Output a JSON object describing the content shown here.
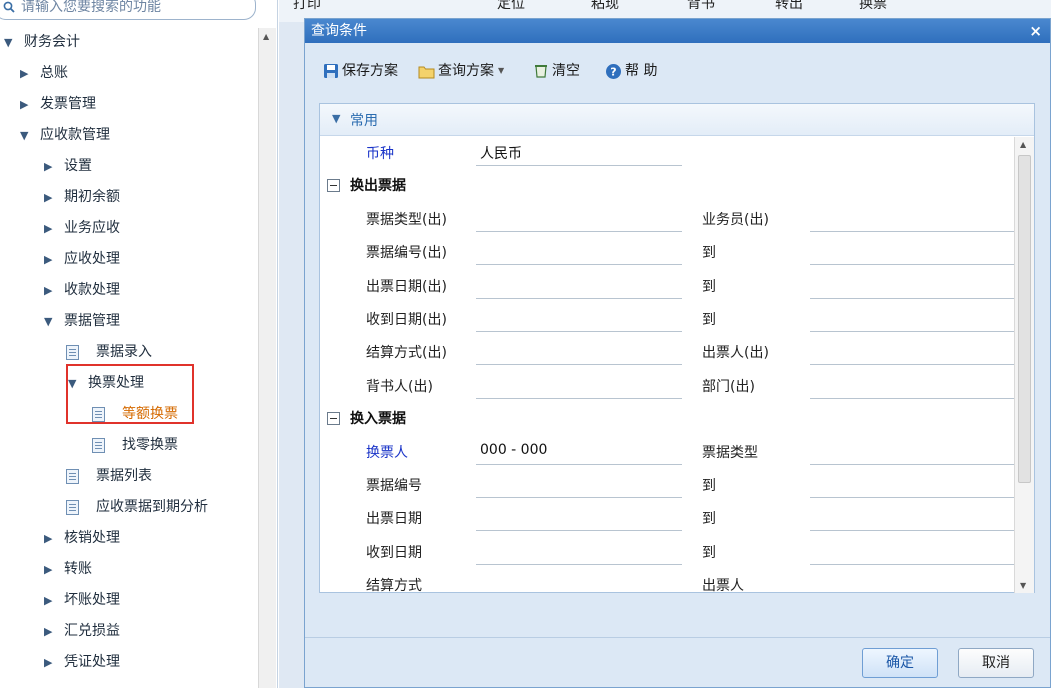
{
  "search": {
    "placeholder": "请输入您要搜索的功能"
  },
  "tree": [
    {
      "label": "财务会计",
      "level": 0,
      "kind": "folder",
      "expanded": true
    },
    {
      "label": "总账",
      "level": 1,
      "kind": "folder",
      "expanded": false
    },
    {
      "label": "发票管理",
      "level": 1,
      "kind": "folder",
      "expanded": false
    },
    {
      "label": "应收款管理",
      "level": 1,
      "kind": "folder",
      "expanded": true
    },
    {
      "label": "设置",
      "level": 2,
      "kind": "folder",
      "expanded": false
    },
    {
      "label": "期初余额",
      "level": 2,
      "kind": "folder",
      "expanded": false
    },
    {
      "label": "业务应收",
      "level": 2,
      "kind": "folder",
      "expanded": false
    },
    {
      "label": "应收处理",
      "level": 2,
      "kind": "folder",
      "expanded": false
    },
    {
      "label": "收款处理",
      "level": 2,
      "kind": "folder",
      "expanded": false
    },
    {
      "label": "票据管理",
      "level": 2,
      "kind": "folder",
      "expanded": true
    },
    {
      "label": "票据录入",
      "level": 3,
      "kind": "doc"
    },
    {
      "label": "换票处理",
      "level": 3,
      "kind": "folder",
      "expanded": true
    },
    {
      "label": "等额换票",
      "level": 4,
      "kind": "doc",
      "active": true
    },
    {
      "label": "找零换票",
      "level": 4,
      "kind": "doc"
    },
    {
      "label": "票据列表",
      "level": 3,
      "kind": "doc"
    },
    {
      "label": "应收票据到期分析",
      "level": 3,
      "kind": "doc"
    },
    {
      "label": "核销处理",
      "level": 2,
      "kind": "folder",
      "expanded": false
    },
    {
      "label": "转账",
      "level": 2,
      "kind": "folder",
      "expanded": false
    },
    {
      "label": "坏账处理",
      "level": 2,
      "kind": "folder",
      "expanded": false
    },
    {
      "label": "汇兑损益",
      "level": 2,
      "kind": "folder",
      "expanded": false
    },
    {
      "label": "凭证处理",
      "level": 2,
      "kind": "folder",
      "expanded": false
    }
  ],
  "background_toolbar": [
    "打印",
    "定位",
    "粘现",
    "背书",
    "转出",
    "换票"
  ],
  "dialog": {
    "title": "查询条件",
    "close": "×",
    "toolbar": {
      "save_scheme": "保存方案",
      "query_scheme": "查询方案",
      "clear": "清空",
      "help": "帮 助"
    },
    "panel_title": "常用",
    "form": {
      "currency": {
        "label": "币种",
        "value": "人民币"
      },
      "section_out": "换出票据",
      "out_rows": [
        {
          "left": "票据类型(出)",
          "right": "业务员(出)"
        },
        {
          "left": "票据编号(出)",
          "right": "到"
        },
        {
          "left": "出票日期(出)",
          "right": "到"
        },
        {
          "left": "收到日期(出)",
          "right": "到"
        },
        {
          "left": "结算方式(出)",
          "right": "出票人(出)"
        },
        {
          "left": "背书人(出)",
          "right": "部门(出)"
        }
      ],
      "section_in": "换入票据",
      "exchanger": {
        "label": "换票人",
        "value": "000 - 000",
        "right": "票据类型"
      },
      "in_rows": [
        {
          "left": "票据编号",
          "right": "到"
        },
        {
          "left": "出票日期",
          "right": "到"
        },
        {
          "left": "收到日期",
          "right": "到"
        },
        {
          "left": "结算方式",
          "right": "出票人"
        }
      ]
    },
    "ok": "确定",
    "cancel": "取消"
  },
  "colors": {
    "title_bar": "#2f6fbd",
    "highlight_box": "#e0322b",
    "active_item": "#d56a00",
    "required_label": "#1a34c8"
  }
}
